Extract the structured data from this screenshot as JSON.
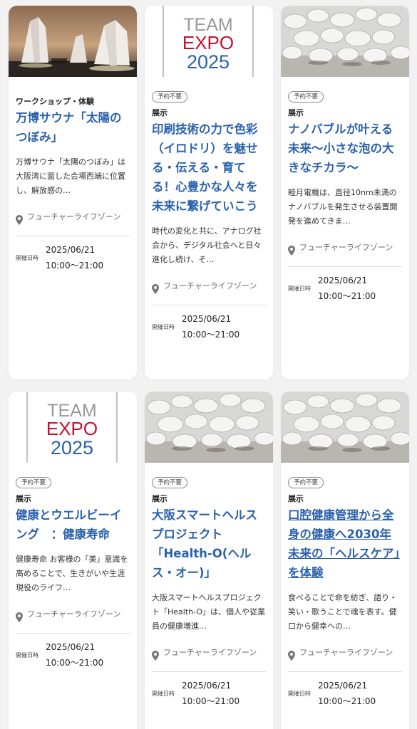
{
  "cards": [
    {
      "badge": "",
      "category": "ワークショップ・体験",
      "title": "万博サウナ「太陽のつぼみ」",
      "desc": "万博サウナ「太陽のつぼみ」は大阪湾に面した会場西端に位置し、解放感の…",
      "location": "フューチャーライフゾーン",
      "date_label": "開催日時",
      "date": "2025/06/21",
      "time": "10:00～21:00"
    },
    {
      "badge": "予約不要",
      "category": "展示",
      "title": "印刷技術の力で色彩（イロドリ）を魅せる・伝える・育てる！心豊かな人々を未来に繋げていこう",
      "desc": "時代の変化と共に、アナログ社会から、デジタル社会へと日々進化し続け、そ…",
      "location": "フューチャーライフゾーン",
      "date_label": "開催日時",
      "date": "2025/06/21",
      "time": "10:00～21:00",
      "logo": {
        "line1": "TEAM",
        "line2": "EXPO",
        "line3": "2025"
      }
    },
    {
      "badge": "予約不要",
      "category": "展示",
      "title": "ナノバブルが叶える未来～小さな泡の大きなチカラ～",
      "desc": "睦月電機は、直径10nm未満のナノバブルを発生させる装置開発を進めてきま…",
      "location": "フューチャーライフゾーン",
      "date_label": "開催日時",
      "date": "2025/06/21",
      "time": "10:00～21:00"
    },
    {
      "badge": "予約不要",
      "category": "展示",
      "title": "健康とウエルビーイング　：健康寿命",
      "desc": "健康寿命 お客様の「美」意識を高めることで、生きがいや生涯現役のライフ…",
      "location": "フューチャーライフゾーン",
      "date_label": "開催日時",
      "date": "2025/06/21",
      "time": "10:00～21:00",
      "logo": {
        "line1": "TEAM",
        "line2": "EXPO",
        "line3": "2025"
      }
    },
    {
      "badge": "予約不要",
      "category": "展示",
      "title": "大阪スマートヘルスプロジェクト「Health-O(ヘルス・オー)」",
      "desc": "大阪スマートヘルスプロジェクト「Health-O」は、個人や従業員の健康増進…",
      "location": "フューチャーライフゾーン",
      "date_label": "開催日時",
      "date": "2025/06/21",
      "time": "10:00～21:00"
    },
    {
      "badge": "予約不要",
      "category": "展示",
      "title": "口腔健康管理から全身の健康へ2030年未来の「ヘルスケア」を体験",
      "desc": "食べることで命を紡ぎ、語り・笑い・歌うことで魂を表す。健口から健幸への…",
      "location": "フューチャーライフゾーン",
      "date_label": "開催日時",
      "date": "2025/06/21",
      "time": "10:00～21:00"
    }
  ],
  "colors": {
    "title": "#2b62ad",
    "expo_red": "#c8102e",
    "expo_blue": "#2b62ad"
  }
}
